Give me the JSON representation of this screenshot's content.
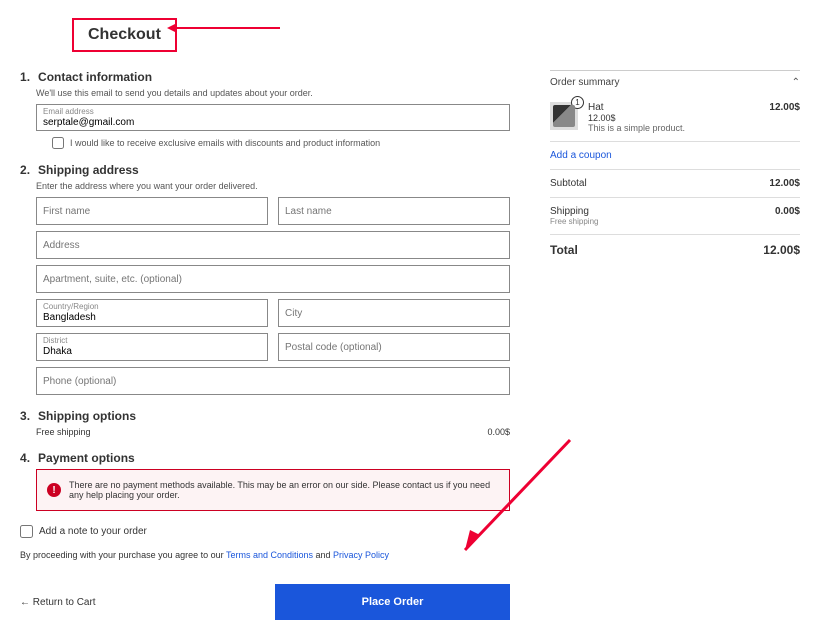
{
  "page_title": "Checkout",
  "contact": {
    "heading": "Contact information",
    "desc": "We'll use this email to send you details and updates about your order.",
    "email_label": "Email address",
    "email_value": "serptale@gmail.com",
    "newsletter": "I would like to receive exclusive emails with discounts and product information"
  },
  "shipping": {
    "heading": "Shipping address",
    "desc": "Enter the address where you want your order delivered.",
    "first_name": "First name",
    "last_name": "Last name",
    "address": "Address",
    "apt": "Apartment, suite, etc. (optional)",
    "country_label": "Country/Region",
    "country_value": "Bangladesh",
    "city": "City",
    "district_label": "District",
    "district_value": "Dhaka",
    "postal": "Postal code (optional)",
    "phone": "Phone (optional)"
  },
  "shipping_opts": {
    "heading": "Shipping options",
    "method": "Free shipping",
    "cost": "0.00$"
  },
  "payment": {
    "heading": "Payment options",
    "error": "There are no payment methods available. This may be an error on our side. Please contact us if you need any help placing your order."
  },
  "note_label": "Add a note to your order",
  "terms_prefix": "By proceeding with your purchase you agree to our ",
  "terms_link1": "Terms and Conditions",
  "terms_and": " and ",
  "terms_link2": "Privacy Policy",
  "return_cart": "Return to Cart",
  "place_order": "Place Order",
  "summary": {
    "heading": "Order summary",
    "product_name": "Hat",
    "product_price_line": "12.00$",
    "product_desc": "This is a simple product.",
    "product_qty": "1",
    "product_total": "12.00$",
    "coupon": "Add a coupon",
    "subtotal_label": "Subtotal",
    "subtotal_value": "12.00$",
    "ship_label": "Shipping",
    "ship_sub": "Free shipping",
    "ship_value": "0.00$",
    "total_label": "Total",
    "total_value": "12.00$"
  }
}
